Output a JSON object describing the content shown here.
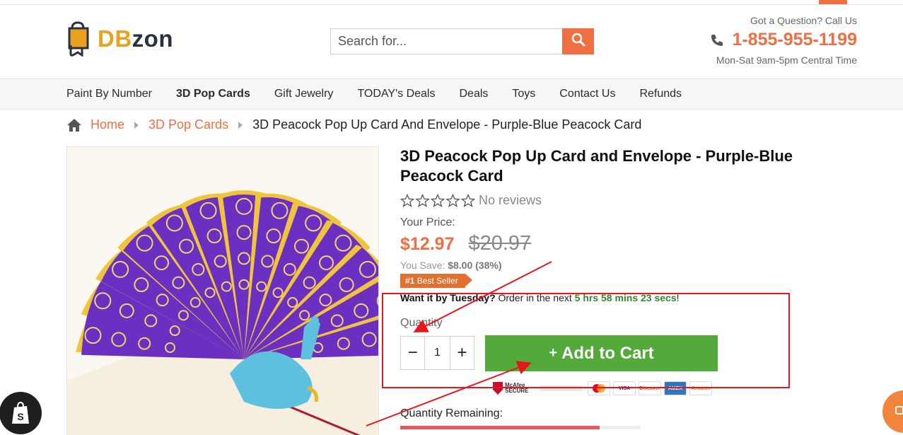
{
  "header": {
    "logo": {
      "part1": "DB",
      "part2": "zon"
    },
    "search": {
      "placeholder": "Search for...",
      "button_icon": "search-icon"
    },
    "contact": {
      "question": "Got a Question? Call Us",
      "phone": "1-855-955-1199",
      "hours": "Mon-Sat 9am-5pm Central Time"
    }
  },
  "nav": {
    "items": [
      {
        "label": "Paint By Number"
      },
      {
        "label": "3D Pop Cards"
      },
      {
        "label": "Gift Jewelry"
      },
      {
        "label": "TODAY's Deals"
      },
      {
        "label": "Deals"
      },
      {
        "label": "Toys"
      },
      {
        "label": "Contact Us"
      },
      {
        "label": "Refunds"
      }
    ],
    "active": "3D Pop Cards"
  },
  "breadcrumb": {
    "home": "Home",
    "category": "3D Pop Cards",
    "current": "3D Peacock Pop Up Card And Envelope - Purple-Blue Peacock Card"
  },
  "product": {
    "title": "3D Peacock Pop Up Card and Envelope - Purple-Blue Peacock Card",
    "rating": {
      "stars": 0,
      "text": "No reviews"
    },
    "price_label": "Your Price:",
    "price": "$12.97",
    "compare_price": "$20.97",
    "save_label": "You Save:",
    "save_amount": "$8.00 (38%)",
    "badge_1": "#1",
    "badge_2": "Best Seller",
    "shipping": {
      "lead": "Want it by Tuesday?",
      "middle": "Order in the next",
      "timer": "5 hrs 58 mins 23 secs",
      "end": "!"
    },
    "quantity_label": "Quantity",
    "quantity": "1",
    "minus": "−",
    "plus": "+",
    "add_to_cart": "Add to Cart",
    "add_plus": "+",
    "trust": {
      "mcafee_1": "McAfee",
      "mcafee_2": "SECURE",
      "cards": [
        "VISA",
        "Discover",
        "AMEX",
        "Amazon"
      ]
    },
    "remaining_label": "Quantity Remaining:",
    "remaining_fraction": 0.83
  },
  "colors": {
    "accent": "#ef6f42",
    "green": "#53a93a",
    "annotation_red": "#e8161b"
  }
}
